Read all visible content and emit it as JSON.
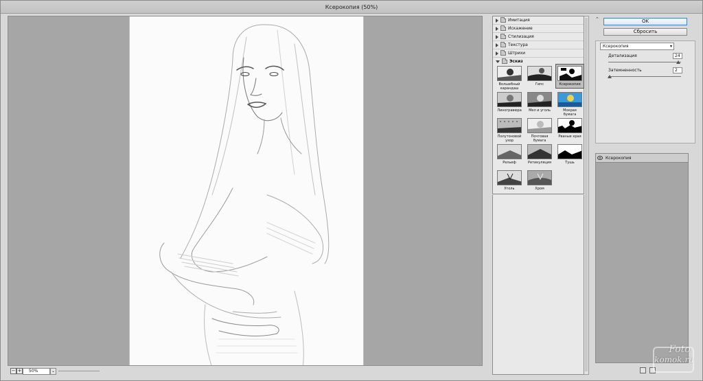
{
  "window": {
    "title": "Ксерокопия (50%)"
  },
  "preview": {
    "zoom": "50%",
    "zoom_out_label": "−",
    "zoom_in_label": "+",
    "dropdown_glyph": "⌄"
  },
  "gallery": {
    "categories": [
      "Имитация",
      "Искажение",
      "Стилизация",
      "Текстура",
      "Штрихи"
    ],
    "open_category": "Эскиз",
    "filters": [
      {
        "label": "Волшебный карандаш",
        "style": "pencil"
      },
      {
        "label": "Гипс",
        "style": "plaster"
      },
      {
        "label": "Ксерокопия",
        "style": "xerox",
        "selected": true
      },
      {
        "label": "Линогравюра",
        "style": "lino"
      },
      {
        "label": "Мел и уголь",
        "style": "chalk"
      },
      {
        "label": "Мокрая бумага",
        "style": "wet"
      },
      {
        "label": "Полутоновой узор",
        "style": "halftone"
      },
      {
        "label": "Почтовая бумага",
        "style": "note"
      },
      {
        "label": "Рваные края",
        "style": "torn"
      },
      {
        "label": "Рельеф",
        "style": "relief"
      },
      {
        "label": "Ретикуляция",
        "style": "retic"
      },
      {
        "label": "Тушь",
        "style": "ink"
      },
      {
        "label": "Уголь",
        "style": "charcoal"
      },
      {
        "label": "Хром",
        "style": "chrome"
      }
    ]
  },
  "controls": {
    "collapse_glyph": "⌃",
    "ok_label": "OK",
    "reset_label": "Сбросить",
    "selected_filter": "Ксерокопия",
    "select_arrow": "▾",
    "params": [
      {
        "label": "Детализация",
        "value": "24",
        "fraction": 0.96
      },
      {
        "label": "Затемненность",
        "value": "2",
        "fraction": 0.02
      }
    ]
  },
  "layers": {
    "items": [
      {
        "name": "Ксерокопия"
      }
    ]
  },
  "watermark": {
    "line1": "Foto",
    "line2": "komok.ru"
  }
}
